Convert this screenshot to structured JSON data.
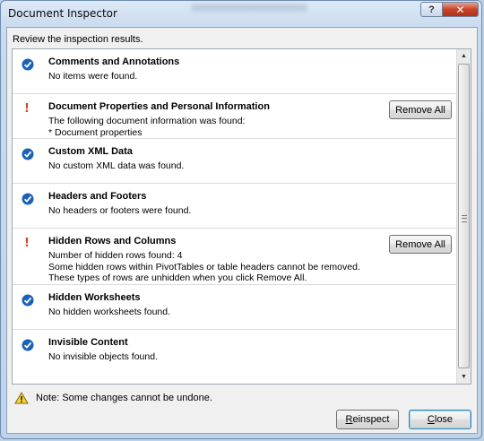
{
  "window": {
    "title": "Document Inspector",
    "help_label": "?",
    "close_label": "✕"
  },
  "instruction": "Review the inspection results.",
  "items": [
    {
      "status": "ok",
      "title": "Comments and Annotations",
      "lines": [
        "No items were found."
      ]
    },
    {
      "status": "warning",
      "title": "Document Properties and Personal Information",
      "lines": [
        "The following document information was found:",
        "* Document properties"
      ],
      "button": "Remove All"
    },
    {
      "status": "ok",
      "title": "Custom XML Data",
      "lines": [
        "No custom XML data was found."
      ]
    },
    {
      "status": "ok",
      "title": "Headers and Footers",
      "lines": [
        "No headers or footers were found."
      ]
    },
    {
      "status": "warning",
      "title": "Hidden Rows and Columns",
      "lines": [
        "Number of hidden rows found: 4",
        "Some hidden rows within PivotTables or table headers cannot be removed.",
        "These types of rows are unhidden when you click Remove All."
      ],
      "button": "Remove All"
    },
    {
      "status": "ok",
      "title": "Hidden Worksheets",
      "lines": [
        "No hidden worksheets found."
      ]
    },
    {
      "status": "ok",
      "title": "Invisible Content",
      "lines": [
        "No invisible objects found."
      ]
    }
  ],
  "note": "Note: Some changes cannot be undone.",
  "buttons": {
    "reinspect_first": "R",
    "reinspect_rest": "einspect",
    "close_first": "C",
    "close_rest": "lose"
  },
  "colors": {
    "ok": "#1a62b8",
    "warning": "#c94a2a",
    "title_bar": "#cbdcef"
  },
  "icons": {
    "ok": "check-circle-icon",
    "warning": "exclamation-icon",
    "note": "warning-triangle-icon"
  }
}
